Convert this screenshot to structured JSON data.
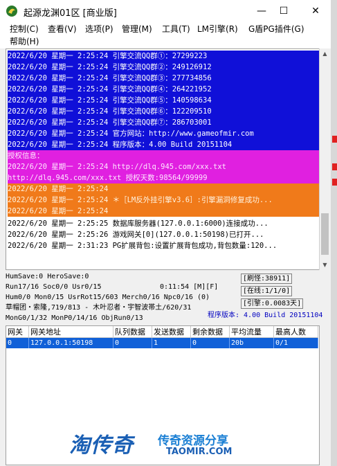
{
  "window": {
    "title": "起源龙渊01区 [商业版]",
    "controls": {
      "minimize": "—",
      "maximize": "☐",
      "close": "✕"
    }
  },
  "menu": [
    "控制(C)",
    "查看(V)",
    "选项(P)",
    "管理(M)",
    "工具(T)",
    "LM引擎(R)",
    "G盾PG插件(G)",
    "帮助(H)"
  ],
  "log": [
    {
      "text": "2022/6/20 星期一 2:25:24 引擎交流QQ群①：27299223",
      "style": "blue"
    },
    {
      "text": "2022/6/20 星期一 2:25:24 引擎交流QQ群②：249126912",
      "style": "blue"
    },
    {
      "text": "2022/6/20 星期一 2:25:24 引擎交流QQ群③：277734856",
      "style": "blue"
    },
    {
      "text": "2022/6/20 星期一 2:25:24 引擎交流QQ群④：264221952",
      "style": "blue"
    },
    {
      "text": "2022/6/20 星期一 2:25:24 引擎交流QQ群⑤：140598634",
      "style": "blue"
    },
    {
      "text": "2022/6/20 星期一 2:25:24 引擎交流QQ群⑥：122209510",
      "style": "blue"
    },
    {
      "text": "2022/6/20 星期一 2:25:24 引擎交流QQ群⑦：286703001",
      "style": "blue"
    },
    {
      "text": "2022/6/20 星期一 2:25:24 官方网站：http://www.gameofmir.com",
      "style": "blue"
    },
    {
      "text": "2022/6/20 星期一 2:25:24 程序版本：4.00 Build 20151104",
      "style": "blue"
    },
    {
      "text": "授权信息：",
      "style": "magenta"
    },
    {
      "text": "2022/6/20 星期一 2:25:24 http://dlq.945.com/xxx.txt",
      "style": "magenta"
    },
    {
      "text": "http://dlq.945.com/xxx.txt 授权天数:98564/99999",
      "style": "magenta"
    },
    {
      "text": "2022/6/20 星期一 2:25:24",
      "style": "orange"
    },
    {
      "text": "2022/6/20 星期一 2:25:24 ＊［LM反外挂引擎v3.6］:引擎漏洞修复成功...",
      "style": "orange"
    },
    {
      "text": "2022/6/20 星期一 2:25:24",
      "style": "orange"
    },
    {
      "text": "2022/6/20 星期一 2:25:25 数据库服务器(127.0.0.1:6000)连接成功...",
      "style": "plain"
    },
    {
      "text": "2022/6/20 星期一 2:25:26 游戏网关[0](127.0.0.1:50198)已打开...",
      "style": "plain"
    },
    {
      "text": "2022/6/20 星期一 2:31:23 PG扩展背包:设置扩展背包成功,背包数量:120...",
      "style": "plain"
    }
  ],
  "status": {
    "line1": "HumSave:0 HeroSave:0",
    "line2": "Run17/16 Soc0/0 Usr0/15",
    "clock": "0:11:54 [M][F]",
    "line3": "Hum0/0 Mon0/15 UsrRot15/603 Merch0/16 Npc0/16 (0)",
    "line4": "草帽团・索隆,719/813 - 木叶忍者・宇智波帯土/620/31",
    "line5": "MonG0/1/32 MonP0/14/16 ObjRun0/13",
    "refresh": "[刷怪:38911]",
    "online": "[在线:1/1/0]",
    "engine": "[引擎:0.0083天]",
    "version": "程序版本: 4.00 Build 20151104"
  },
  "grid": {
    "headers": [
      "网关",
      "网关地址",
      "队列数据",
      "发送数据",
      "剩余数据",
      "平均流量",
      "最高人数"
    ],
    "rows": [
      [
        "0",
        "127.0.0.1:50198",
        "0",
        "1",
        "0",
        "20b",
        "0/1"
      ]
    ]
  },
  "watermark": {
    "logo": "淘传奇",
    "cn": "传奇资源分享",
    "en": "TAOMIR.COM"
  }
}
